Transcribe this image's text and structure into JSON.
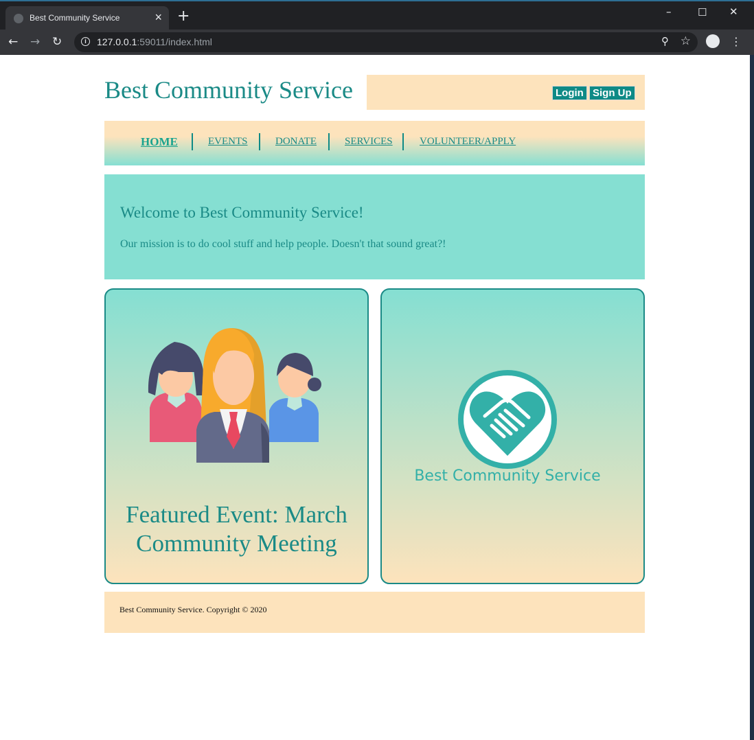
{
  "browser": {
    "tab_title": "Best Community Service",
    "url_host": "127.0.0.1",
    "url_rest": ":59011/index.html"
  },
  "site": {
    "title": "Best Community Service",
    "login_label": "Login",
    "signup_label": "Sign Up"
  },
  "nav": {
    "items": [
      {
        "label": "HOME",
        "active": true
      },
      {
        "label": "EVENTS"
      },
      {
        "label": "DONATE"
      },
      {
        "label": "SERVICES"
      },
      {
        "label": "VOLUNTEER/APPLY"
      }
    ]
  },
  "welcome": {
    "heading": "Welcome to Best Community Service!",
    "text": "Our mission is to do cool stuff and help people. Doesn't that sound great?!"
  },
  "featured": {
    "title": "Featured Event: March Community Meeting"
  },
  "logo": {
    "text": "Best Community Service"
  },
  "footer": {
    "text": "Best Community Service. Copyright © 2020"
  },
  "colors": {
    "teal": "#1a8a86",
    "aqua": "#85dfd2",
    "peach": "#fde3bc",
    "button": "#0e8a86"
  }
}
